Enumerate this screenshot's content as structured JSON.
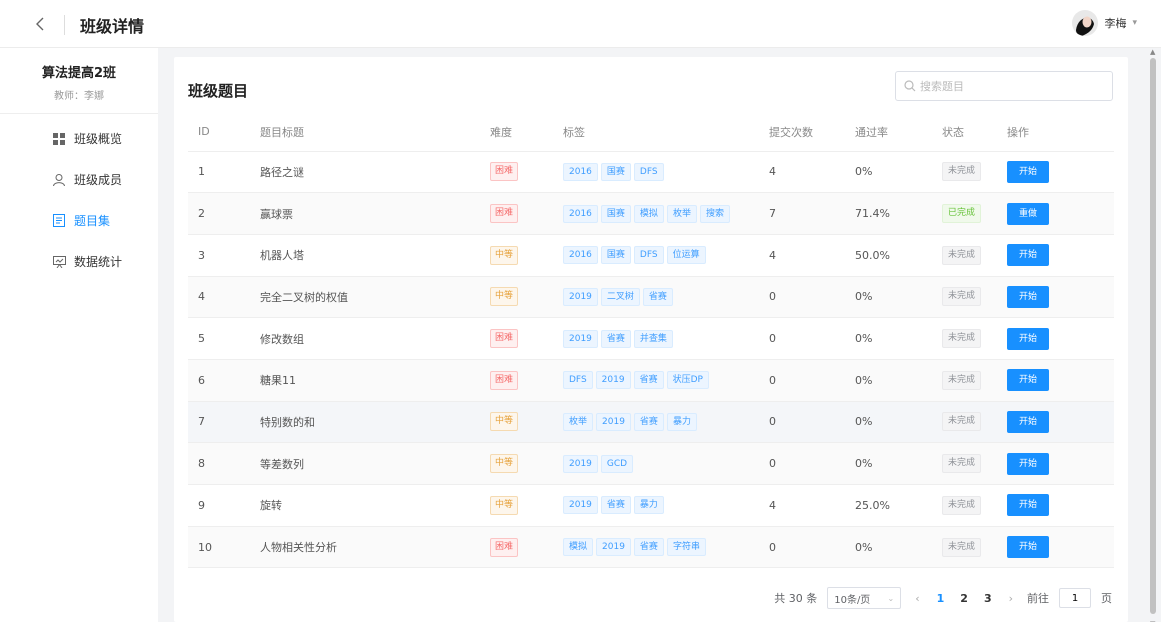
{
  "header": {
    "title": "班级详情",
    "user_name": "李梅"
  },
  "sidebar": {
    "class_name": "算法提高2班",
    "teacher": "教师：李娜",
    "items": [
      {
        "label": "班级概览",
        "icon": "grid-icon",
        "active": false
      },
      {
        "label": "班级成员",
        "icon": "user-icon",
        "active": false
      },
      {
        "label": "题目集",
        "icon": "document-icon",
        "active": true
      },
      {
        "label": "数据统计",
        "icon": "chart-board-icon",
        "active": false
      }
    ]
  },
  "main": {
    "title": "班级题目",
    "search_placeholder": "搜索题目",
    "columns": [
      "ID",
      "题目标题",
      "难度",
      "标签",
      "提交次数",
      "通过率",
      "状态",
      "操作"
    ],
    "rows": [
      {
        "id": "1",
        "title": "路径之谜",
        "difficulty": "困难",
        "level": "hard",
        "tags": [
          "2016",
          "国赛",
          "DFS"
        ],
        "submissions": "4",
        "rate": "0%",
        "status": "未完成",
        "done": false,
        "action": "开始"
      },
      {
        "id": "2",
        "title": "赢球票",
        "difficulty": "困难",
        "level": "hard",
        "tags": [
          "2016",
          "国赛",
          "模拟",
          "枚举",
          "搜索"
        ],
        "submissions": "7",
        "rate": "71.4%",
        "status": "已完成",
        "done": true,
        "action": "重做"
      },
      {
        "id": "3",
        "title": "机器人塔",
        "difficulty": "中等",
        "level": "mid",
        "tags": [
          "2016",
          "国赛",
          "DFS",
          "位运算"
        ],
        "submissions": "4",
        "rate": "50.0%",
        "status": "未完成",
        "done": false,
        "action": "开始"
      },
      {
        "id": "4",
        "title": "完全二叉树的权值",
        "difficulty": "中等",
        "level": "mid",
        "tags": [
          "2019",
          "二叉树",
          "省赛"
        ],
        "submissions": "0",
        "rate": "0%",
        "status": "未完成",
        "done": false,
        "action": "开始"
      },
      {
        "id": "5",
        "title": "修改数组",
        "difficulty": "困难",
        "level": "hard",
        "tags": [
          "2019",
          "省赛",
          "并查集"
        ],
        "submissions": "0",
        "rate": "0%",
        "status": "未完成",
        "done": false,
        "action": "开始"
      },
      {
        "id": "6",
        "title": "糖果11",
        "difficulty": "困难",
        "level": "hard",
        "tags": [
          "DFS",
          "2019",
          "省赛",
          "状压DP"
        ],
        "submissions": "0",
        "rate": "0%",
        "status": "未完成",
        "done": false,
        "action": "开始"
      },
      {
        "id": "7",
        "title": "特别数的和",
        "difficulty": "中等",
        "level": "mid",
        "tags": [
          "枚举",
          "2019",
          "省赛",
          "暴力"
        ],
        "submissions": "0",
        "rate": "0%",
        "status": "未完成",
        "done": false,
        "action": "开始"
      },
      {
        "id": "8",
        "title": "等差数列",
        "difficulty": "中等",
        "level": "mid",
        "tags": [
          "2019",
          "GCD"
        ],
        "submissions": "0",
        "rate": "0%",
        "status": "未完成",
        "done": false,
        "action": "开始"
      },
      {
        "id": "9",
        "title": "旋转",
        "difficulty": "中等",
        "level": "mid",
        "tags": [
          "2019",
          "省赛",
          "暴力"
        ],
        "submissions": "4",
        "rate": "25.0%",
        "status": "未完成",
        "done": false,
        "action": "开始"
      },
      {
        "id": "10",
        "title": "人物相关性分析",
        "difficulty": "困难",
        "level": "hard",
        "tags": [
          "模拟",
          "2019",
          "省赛",
          "字符串"
        ],
        "submissions": "0",
        "rate": "0%",
        "status": "未完成",
        "done": false,
        "action": "开始"
      }
    ]
  },
  "pagination": {
    "total_text": "共 30 条",
    "page_size": "10条/页",
    "pages": [
      "1",
      "2",
      "3"
    ],
    "current": "1",
    "goto_label": "前往",
    "goto_value": "1",
    "page_unit": "页"
  },
  "colors": {
    "primary": "#1890ff",
    "hard": "#f56c6c",
    "medium": "#e6a23c",
    "done": "#67c23a"
  }
}
